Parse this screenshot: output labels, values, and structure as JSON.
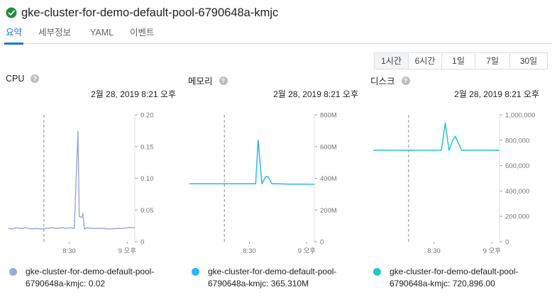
{
  "header": {
    "title": "gke-cluster-for-demo-default-pool-6790648a-kmjc",
    "status_icon": "check-circle-icon",
    "status_color": "#1e8e3e"
  },
  "tabs": [
    {
      "label": "요약",
      "active": true
    },
    {
      "label": "세부정보",
      "active": false
    },
    {
      "label": "YAML",
      "active": false
    },
    {
      "label": "이벤트",
      "active": false
    }
  ],
  "time_ranges": [
    {
      "label": "1시간",
      "active": true
    },
    {
      "label": "6시간",
      "active": false
    },
    {
      "label": "1일",
      "active": false
    },
    {
      "label": "7일",
      "active": false
    },
    {
      "label": "30일",
      "active": false
    }
  ],
  "panels": [
    {
      "title": "CPU",
      "date": "2월 28, 2019 8:21 오후",
      "legend_line1": "gke-cluster-for-demo-default-pool-",
      "legend_line2": "6790648a-kmjc: 0.02",
      "color": "#9fa8da"
    },
    {
      "title": "메모리",
      "date": "2월 28, 2019 8:21 오후",
      "legend_line1": "gke-cluster-for-demo-default-pool-",
      "legend_line2": "6790648a-kmjc: 365.310M",
      "color": "#29b6f6"
    },
    {
      "title": "디스크",
      "date": "2월 28, 2019 8:21 오후",
      "legend_line1": "gke-cluster-for-demo-default-pool-",
      "legend_line2": "6790648a-kmjc: 720,896.00",
      "color": "#26c6c6"
    }
  ],
  "chart_data": [
    {
      "type": "line",
      "title": "CPU",
      "x_ticks": [
        "8:30",
        "9 오후"
      ],
      "y_ticks": [
        "0",
        "0.05",
        "0.10",
        "0.15",
        "0.20"
      ],
      "ylim": [
        0,
        0.2
      ],
      "cursor_x": 0.28,
      "x": [
        0,
        0.03,
        0.06,
        0.1,
        0.14,
        0.18,
        0.22,
        0.27,
        0.3,
        0.34,
        0.38,
        0.42,
        0.46,
        0.49,
        0.52,
        0.53,
        0.55,
        0.56,
        0.58,
        0.59,
        0.6,
        0.62,
        0.65,
        0.7,
        0.75,
        0.8,
        0.85,
        0.9,
        0.95,
        1.0
      ],
      "series": [
        {
          "values": [
            0.021,
            0.02,
            0.022,
            0.021,
            0.022,
            0.02,
            0.021,
            0.02,
            0.021,
            0.022,
            0.021,
            0.022,
            0.021,
            0.022,
            0.021,
            0.07,
            0.174,
            0.04,
            0.038,
            0.045,
            0.02,
            0.022,
            0.021,
            0.021,
            0.021,
            0.02,
            0.021,
            0.021,
            0.022,
            0.022
          ]
        }
      ]
    },
    {
      "type": "line",
      "title": "메모리",
      "x_ticks": [
        "8:30",
        "9 오후"
      ],
      "y_ticks": [
        "0",
        "200M",
        "400M",
        "600M",
        "800M"
      ],
      "ylim": [
        0,
        800
      ],
      "cursor_x": 0.28,
      "x": [
        0,
        0.1,
        0.2,
        0.3,
        0.4,
        0.45,
        0.5,
        0.53,
        0.55,
        0.58,
        0.61,
        0.63,
        0.66,
        0.7,
        0.8,
        0.9,
        1.0
      ],
      "series": [
        {
          "values": [
            365,
            365,
            365,
            365,
            365,
            365,
            365,
            365,
            640,
            365,
            410,
            410,
            365,
            365,
            363,
            363,
            362
          ]
        }
      ]
    },
    {
      "type": "line",
      "title": "디스크",
      "x_ticks": [
        "8:30",
        "9 오후"
      ],
      "y_ticks": [
        "0",
        "200,000",
        "400,000",
        "600,000",
        "800,000",
        "1,000,000"
      ],
      "ylim": [
        0,
        1000000
      ],
      "cursor_x": 0.28,
      "x": [
        0,
        0.1,
        0.2,
        0.3,
        0.4,
        0.5,
        0.52,
        0.54,
        0.57,
        0.6,
        0.63,
        0.65,
        0.7,
        0.8,
        0.9,
        1.0
      ],
      "series": [
        {
          "values": [
            720896,
            720896,
            720896,
            720896,
            720896,
            720896,
            720896,
            720896,
            935000,
            720896,
            800000,
            830000,
            720896,
            720896,
            720896,
            720896
          ]
        }
      ]
    }
  ]
}
